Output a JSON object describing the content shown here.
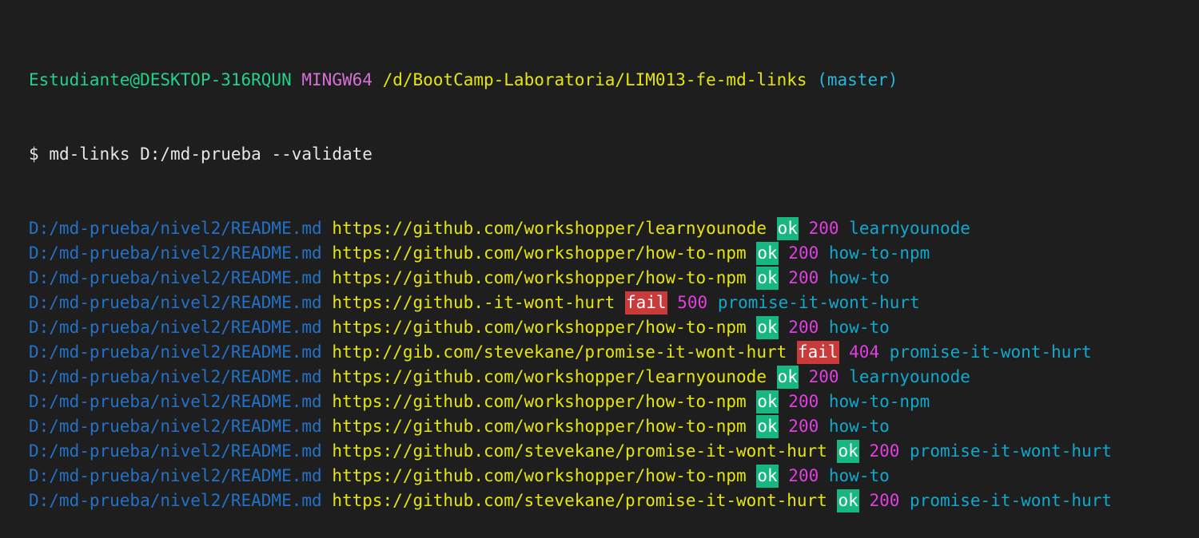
{
  "prompt_header": {
    "user_host": "Estudiante@DESKTOP-316RQUN",
    "system": "MINGW64",
    "cwd": "/d/BootCamp-Laboratoria/LIM013-fe-md-links",
    "branch": "(master)"
  },
  "command": {
    "symbol": "$",
    "text": "md-links D:/md-prueba --validate"
  },
  "colors": {
    "background": "#1e1e1e",
    "ok_badge": "#16b880",
    "fail_badge": "#c93b3b",
    "file_path": "#2472c8",
    "url": "#e5e510",
    "status_code": "#e040e0",
    "link_text": "#11a8cd"
  },
  "results": [
    {
      "file": "D:/md-prueba/nivel2/README.md",
      "href": "https://github.com/workshopper/learnyounode",
      "status": "ok",
      "code": "200",
      "text": "learnyounode"
    },
    {
      "file": "D:/md-prueba/nivel2/README.md",
      "href": "https://github.com/workshopper/how-to-npm",
      "status": "ok",
      "code": "200",
      "text": "how-to-npm"
    },
    {
      "file": "D:/md-prueba/nivel2/README.md",
      "href": "https://github.com/workshopper/how-to-npm",
      "status": "ok",
      "code": "200",
      "text": "how-to"
    },
    {
      "file": "D:/md-prueba/nivel2/README.md",
      "href": "https://github.-it-wont-hurt",
      "status": "fail",
      "code": "500",
      "text": "promise-it-wont-hurt"
    },
    {
      "file": "D:/md-prueba/nivel2/README.md",
      "href": "https://github.com/workshopper/how-to-npm",
      "status": "ok",
      "code": "200",
      "text": "how-to"
    },
    {
      "file": "D:/md-prueba/nivel2/README.md",
      "href": "http://gib.com/stevekane/promise-it-wont-hurt",
      "status": "fail",
      "code": "404",
      "text": "promise-it-wont-hurt"
    },
    {
      "file": "D:/md-prueba/nivel2/README.md",
      "href": "https://github.com/workshopper/learnyounode",
      "status": "ok",
      "code": "200",
      "text": "learnyounode"
    },
    {
      "file": "D:/md-prueba/nivel2/README.md",
      "href": "https://github.com/workshopper/how-to-npm",
      "status": "ok",
      "code": "200",
      "text": "how-to-npm"
    },
    {
      "file": "D:/md-prueba/nivel2/README.md",
      "href": "https://github.com/workshopper/how-to-npm",
      "status": "ok",
      "code": "200",
      "text": "how-to"
    },
    {
      "file": "D:/md-prueba/nivel2/README.md",
      "href": "https://github.com/stevekane/promise-it-wont-hurt",
      "status": "ok",
      "code": "200",
      "text": "promise-it-wont-hurt"
    },
    {
      "file": "D:/md-prueba/nivel2/README.md",
      "href": "https://github.com/workshopper/how-to-npm",
      "status": "ok",
      "code": "200",
      "text": "how-to"
    },
    {
      "file": "D:/md-prueba/nivel2/README.md",
      "href": "https://github.com/stevekane/promise-it-wont-hurt",
      "status": "ok",
      "code": "200",
      "text": "promise-it-wont-hurt"
    }
  ]
}
